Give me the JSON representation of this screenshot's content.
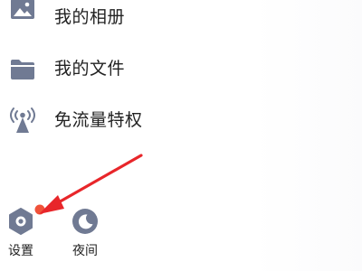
{
  "menu": {
    "items": [
      {
        "label": "我的相册",
        "icon": "photo-album-icon"
      },
      {
        "label": "我的文件",
        "icon": "folder-icon"
      },
      {
        "label": "免流量特权",
        "icon": "signal-tower-icon"
      }
    ]
  },
  "bottom_bar": {
    "settings": {
      "label": "设置",
      "icon": "settings-hexagon-icon"
    },
    "night": {
      "label": "夜间",
      "icon": "moon-icon"
    }
  },
  "annotation": {
    "arrow_color": "#e8262a",
    "dot_color": "#f0523a"
  },
  "colors": {
    "icon_gray": "#707a93",
    "text": "#222222",
    "background": "#ffffff"
  }
}
